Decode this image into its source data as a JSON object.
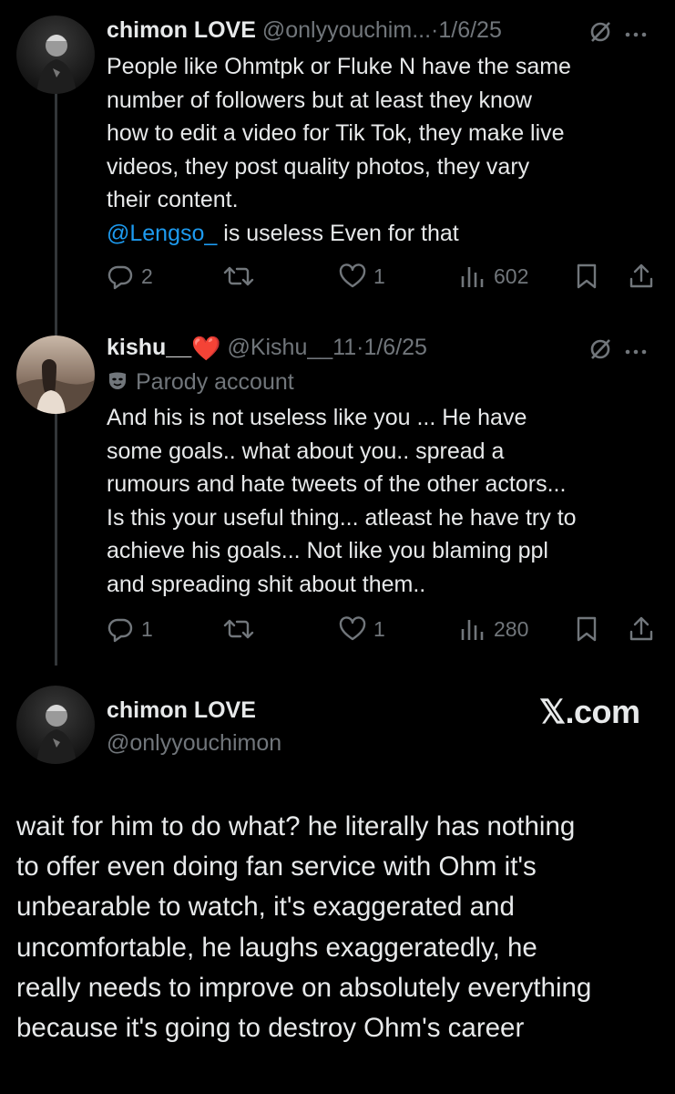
{
  "tweet1": {
    "display_name": "chimon LOVE",
    "handle": "@onlyyouchim...",
    "sep": "·",
    "date": "1/6/25",
    "text_lines": [
      "People like Ohmtpk or Fluke N have the same",
      "number of followers but at least they know",
      "how to edit a video for Tik Tok, they make live",
      "videos, they post quality photos, they vary",
      "their content."
    ],
    "mention": "@Lengso_",
    "mention_tail": " is useless Even for that",
    "replies": "2",
    "likes": "1",
    "views": "602"
  },
  "tweet2": {
    "display_name": "kishu__",
    "badge": "❤️",
    "handle": "@Kishu__11",
    "sep": "·",
    "date": "1/6/25",
    "parody_label": "Parody account",
    "text_lines": [
      "And his is not useless like you ... He have",
      "some goals.. what about you.. spread a",
      "rumours and hate tweets of the other actors...",
      "Is this your useful thing... atleast he have try to",
      "achieve his goals... Not like you blaming ppl",
      "and spreading shit about them.."
    ],
    "replies": "1",
    "likes": "1",
    "views": "280"
  },
  "card": {
    "display_name": "chimon LOVE",
    "handle": "@onlyyouchimon",
    "brand": "𝕏.com",
    "text_lines": [
      "wait for him to do what? he literally has nothing",
      "to offer even doing fan service with Ohm it's",
      "unbearable to watch, it's exaggerated and",
      "uncomfortable, he laughs exaggeratedly, he",
      "really needs to improve on absolutely everything",
      "because it's going to destroy Ohm's career"
    ]
  },
  "colors": {
    "background": "#000000",
    "text": "#e7e9ea",
    "muted": "#71767b",
    "link": "#1d9bf0",
    "thread": "#333639"
  },
  "icons": [
    "reply-icon",
    "retweet-icon",
    "like-icon",
    "views-icon",
    "bookmark-icon",
    "share-icon",
    "grok-icon",
    "more-icon",
    "parody-mask-icon"
  ]
}
